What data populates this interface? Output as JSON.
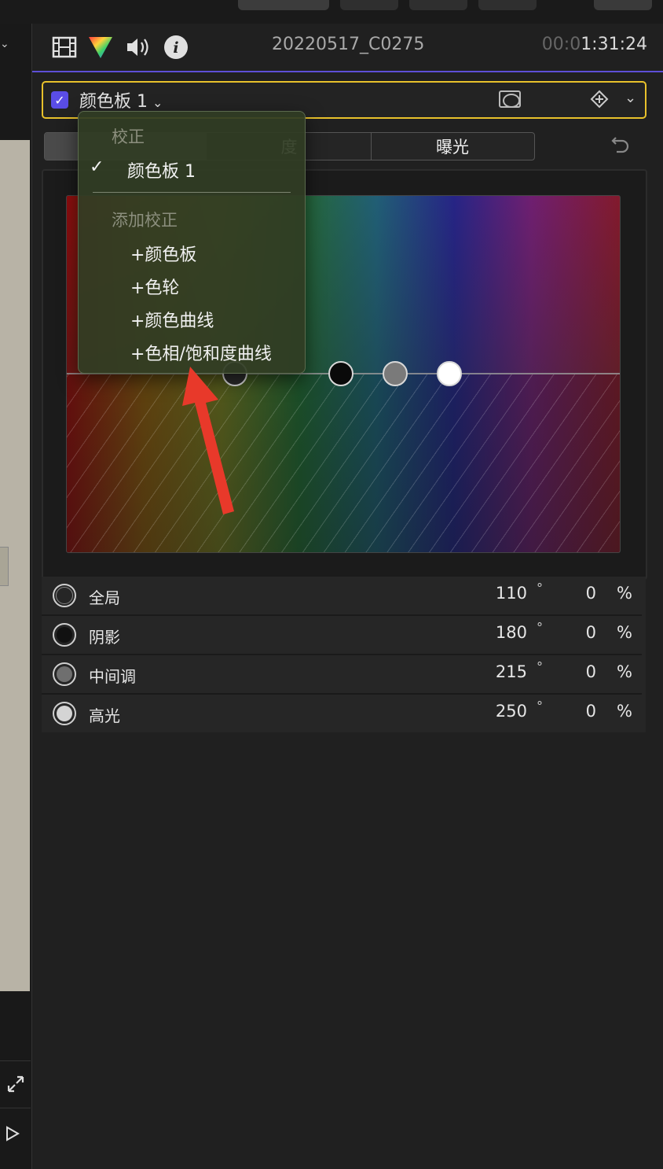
{
  "header": {
    "clip_name": "20220517_C0275",
    "timecode_dim": "00:0",
    "timecode_main": "1:31:24"
  },
  "correction": {
    "title": "颜色板 1",
    "checked": true
  },
  "tabs": [
    {
      "label": ""
    },
    {
      "label": "度"
    },
    {
      "label": "曝光"
    }
  ],
  "menu": {
    "section1_header": "校正",
    "current_item": "颜色板 1",
    "check_glyph": "✓",
    "section2_header": "添加校正",
    "add_items": [
      "+颜色板",
      "+色轮",
      "+颜色曲线",
      "+色相/饱和度曲线"
    ]
  },
  "params": [
    {
      "label": "全局",
      "angle": "110",
      "deg": "°",
      "sat": "0",
      "pct": "%",
      "color": "#262626"
    },
    {
      "label": "阴影",
      "angle": "180",
      "deg": "°",
      "sat": "0",
      "pct": "%",
      "color": "#111111"
    },
    {
      "label": "中间调",
      "angle": "215",
      "deg": "°",
      "sat": "0",
      "pct": "%",
      "color": "#6f6f6f"
    },
    {
      "label": "高光",
      "angle": "250",
      "deg": "°",
      "sat": "0",
      "pct": "%",
      "color": "#d4d4d4"
    }
  ],
  "colors": {
    "accent": "#5a4de6",
    "highlight_border": "#e8c12b",
    "annotation_arrow": "#e8392a"
  }
}
